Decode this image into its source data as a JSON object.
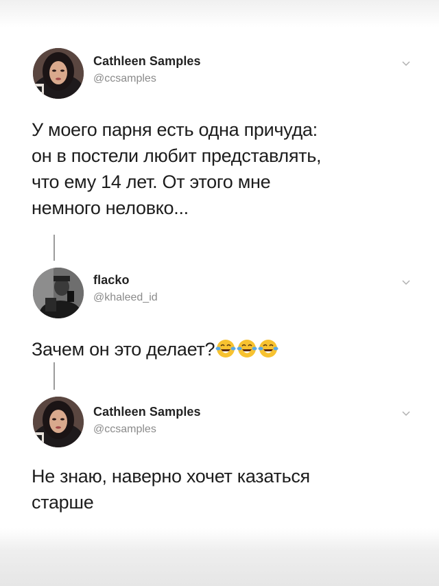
{
  "tweets": [
    {
      "name": "Cathleen Samples",
      "handle": "@ccsamples",
      "text_lines": [
        "У моего парня есть одна причуда:",
        "он в постели любит представлять,",
        "что ему 14 лет. От этого мне",
        "немного неловко..."
      ],
      "avatar_icon": "woman-portrait-avatar",
      "menu_icon": "chevron-down-icon"
    },
    {
      "name": "flacko",
      "handle": "@khaleed_id",
      "text": "Зачем он это делает?",
      "emojis": [
        "face-with-tears-of-joy",
        "face-with-tears-of-joy",
        "face-with-tears-of-joy"
      ],
      "avatar_icon": "man-mirror-selfie-avatar",
      "menu_icon": "chevron-down-icon"
    },
    {
      "name": "Cathleen Samples",
      "handle": "@ccsamples",
      "text_lines": [
        "Не знаю, наверно хочет казаться",
        "старше"
      ],
      "avatar_icon": "woman-portrait-avatar",
      "menu_icon": "chevron-down-icon"
    }
  ],
  "colors": {
    "text": "#1d1d1d",
    "handle": "#8a8a8a",
    "thread_line": "#9a9a9a",
    "emoji_face": "#f7c230"
  }
}
